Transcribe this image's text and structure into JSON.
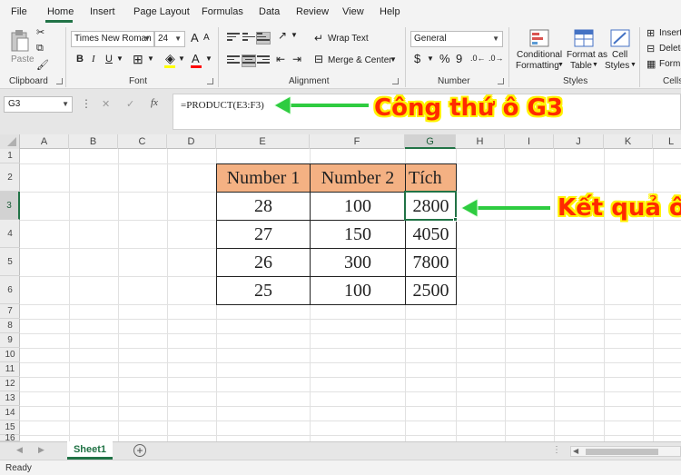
{
  "menu": {
    "file": "File",
    "home": "Home",
    "insert": "Insert",
    "page_layout": "Page Layout",
    "formulas": "Formulas",
    "data": "Data",
    "review": "Review",
    "view": "View",
    "help": "Help"
  },
  "ribbon": {
    "clipboard": {
      "paste": "Paste",
      "label": "Clipboard"
    },
    "font": {
      "name": "Times New Roman",
      "size": "24",
      "bold": "B",
      "italic": "I",
      "underline": "U",
      "font_color_glyph": "A",
      "grow_glyph": "A",
      "shrink_glyph": "A",
      "label": "Font"
    },
    "alignment": {
      "wrap_text": "Wrap Text",
      "merge_center": "Merge & Center",
      "label": "Alignment"
    },
    "number": {
      "format": "General",
      "currency": "$",
      "percent": "%",
      "comma": "9",
      "label": "Number"
    },
    "styles": {
      "conditional_1": "Conditional",
      "conditional_2": "Formatting",
      "format_as_1": "Format as",
      "format_as_2": "Table",
      "cell_1": "Cell",
      "cell_2": "Styles",
      "label": "Styles"
    },
    "cells": {
      "insert": "Insert",
      "delete": "Delete",
      "format": "Form",
      "label": "Cells"
    }
  },
  "formula_bar": {
    "name_box": "G3",
    "fx": "fx",
    "cancel": "✕",
    "enter": "✓",
    "formula": "=PRODUCT(E3:F3)"
  },
  "columns": [
    "A",
    "B",
    "C",
    "D",
    "E",
    "F",
    "G",
    "H",
    "I",
    "J",
    "K",
    "L"
  ],
  "rows": [
    "1",
    "2",
    "3",
    "4",
    "5",
    "6",
    "7",
    "8",
    "9",
    "10",
    "11",
    "12",
    "13",
    "14",
    "15",
    "16"
  ],
  "table": {
    "headers": [
      "Number 1",
      "Number 2",
      "Tích"
    ],
    "rows": [
      [
        "28",
        "100",
        "2800"
      ],
      [
        "27",
        "150",
        "4050"
      ],
      [
        "26",
        "300",
        "7800"
      ],
      [
        "25",
        "100",
        "2500"
      ]
    ]
  },
  "annotations": {
    "formula_note": "Công thứ ô G3",
    "result_note": "Kết quả ô"
  },
  "sheet_tab": "Sheet1",
  "add_sheet": "+",
  "status": "Ready",
  "colors": {
    "accent": "#217346",
    "header_fill": "#f4b183",
    "annotation_text": "#ff2a00",
    "annotation_outline": "#fff200",
    "arrow": "#2ecc40"
  }
}
